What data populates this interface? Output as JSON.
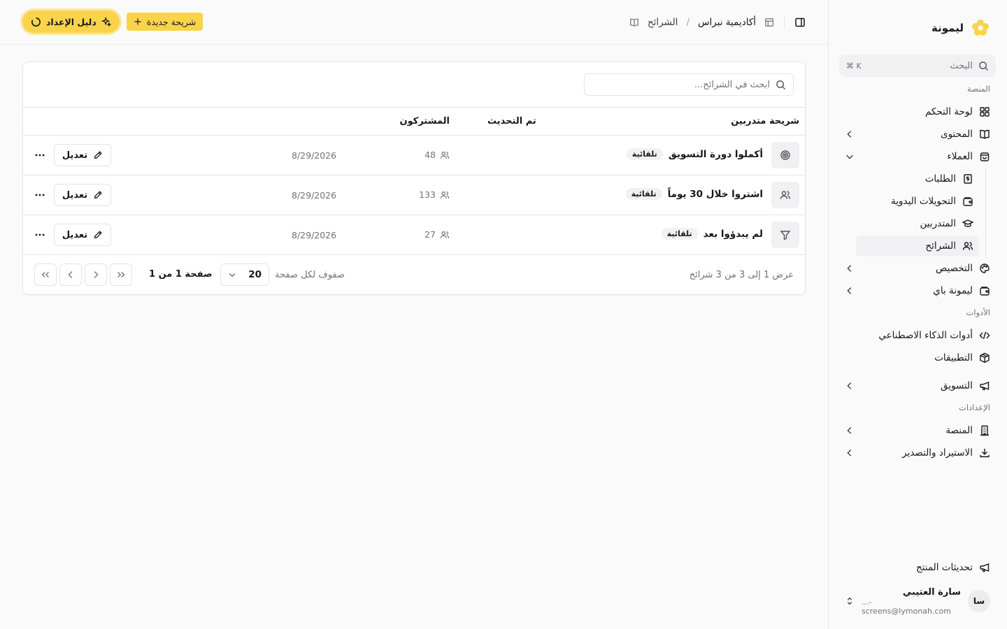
{
  "brand": {
    "name": "ليمونة",
    "accent": "#f9d34a"
  },
  "sidebar": {
    "search_placeholder": "البحث",
    "search_shortcut": "⌘ K",
    "groups": {
      "platform": "المنصة",
      "tools": "الأدوات",
      "settings": "الإعدادات"
    },
    "items": {
      "dashboard": "لوحة التحكم",
      "content": "المحتوى",
      "clients": "العملاء",
      "orders": "الطلبات",
      "manual_transfers": "التحويلات اليدوية",
      "trainees": "المتدربين",
      "segments": "الشرائح",
      "customization": "التخصيص",
      "lymona_pay": "ليمونة باي",
      "ai_tools": "أدوات الذكاء الاصطناعي",
      "apps": "التطبيقات",
      "marketing": "التسويق",
      "platform_settings": "المنصة",
      "import_export": "الاستيراد والتصدير",
      "product_updates": "تحديثات المنتج"
    },
    "user": {
      "initials": "سا",
      "name": "سارة العتيبي",
      "email": "...-screens@lymonah.com"
    }
  },
  "header": {
    "crumb_academy": "أكاديمية نبراس",
    "crumb_segments": "الشرائح",
    "new_segment": "شريحة جديدة",
    "setup_guide": "دليل الإعداد"
  },
  "table": {
    "search_placeholder": "ابحث في الشرائح...",
    "columns": {
      "segment": "شريحة متدربين",
      "subscribers": "المشتركون",
      "updated": "تم التحديث"
    },
    "rows": [
      {
        "name": "أكملوا دورة التسويق",
        "badge": "تلقائية",
        "subscribers": "48",
        "updated": "8/29/2026",
        "edit": "تعديل",
        "icon": "target-icon"
      },
      {
        "name": "اشتروا خلال 30 يوماً",
        "badge": "تلقائية",
        "subscribers": "133",
        "updated": "8/29/2026",
        "edit": "تعديل",
        "icon": "users-icon"
      },
      {
        "name": "لم يبدؤوا بعد",
        "badge": "تلقائية",
        "subscribers": "27",
        "updated": "8/29/2026",
        "edit": "تعديل",
        "icon": "filter-icon"
      }
    ],
    "pager": {
      "summary": "عرض 1 إلى 3 من 3 شرائح",
      "rows_per_page_label": "صفوف لكل صفحة",
      "rows_per_page": "20",
      "page_info": "صفحة 1 من 1"
    }
  }
}
